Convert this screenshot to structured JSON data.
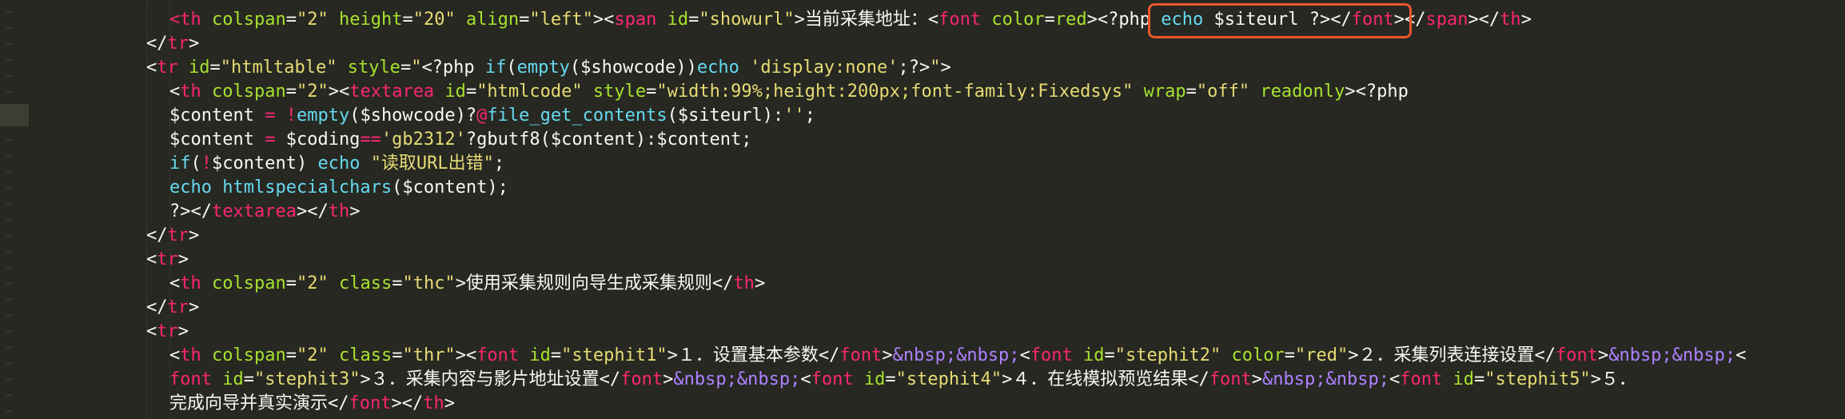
{
  "editor": {
    "theme": "monokai",
    "colors": {
      "background": "#272822",
      "tag": "#f92672",
      "attribute": "#a6e22e",
      "string": "#e6db74",
      "keyword": "#66d9ef",
      "text": "#f8f8f2",
      "entity": "#ae81ff",
      "annotation": "#e8572a"
    },
    "lines": [
      [
        [
          "tag",
          "<th"
        ],
        [
          "pl",
          " "
        ],
        [
          "attr",
          "colspan"
        ],
        [
          "pl",
          "="
        ],
        [
          "str",
          "\"2\""
        ],
        [
          "pl",
          " "
        ],
        [
          "attr",
          "height"
        ],
        [
          "pl",
          "="
        ],
        [
          "str",
          "\"20\""
        ],
        [
          "pl",
          " "
        ],
        [
          "attr",
          "align"
        ],
        [
          "pl",
          "="
        ],
        [
          "str",
          "\"left\""
        ],
        [
          "pl",
          "><"
        ],
        [
          "tag",
          "span"
        ],
        [
          "pl",
          " "
        ],
        [
          "attr",
          "id"
        ],
        [
          "pl",
          "="
        ],
        [
          "str",
          "\"showurl\""
        ],
        [
          "pl",
          ">当前采集地址：<"
        ],
        [
          "tag",
          "font"
        ],
        [
          "pl",
          " "
        ],
        [
          "attr",
          "color"
        ],
        [
          "pl",
          "="
        ],
        [
          "attr",
          "red"
        ],
        [
          "pl",
          "><?php "
        ],
        [
          "kw",
          "echo"
        ],
        [
          "pl",
          " $siteurl ?></"
        ],
        [
          "tag",
          "font"
        ],
        [
          "pl",
          "></"
        ],
        [
          "tag",
          "span"
        ],
        [
          "pl",
          "></"
        ],
        [
          "tag",
          "th"
        ],
        [
          "pl",
          ">"
        ]
      ],
      [
        [
          "pl",
          "</"
        ],
        [
          "tag",
          "tr"
        ],
        [
          "pl",
          ">"
        ]
      ],
      [
        [
          "pl",
          "<"
        ],
        [
          "tag",
          "tr"
        ],
        [
          "pl",
          " "
        ],
        [
          "attr",
          "id"
        ],
        [
          "pl",
          "="
        ],
        [
          "str",
          "\"htmltable\""
        ],
        [
          "pl",
          " "
        ],
        [
          "attr",
          "style"
        ],
        [
          "pl",
          "="
        ],
        [
          "str",
          "\""
        ],
        [
          "pl",
          "<?php "
        ],
        [
          "kw",
          "if"
        ],
        [
          "pl",
          "("
        ],
        [
          "fn",
          "empty"
        ],
        [
          "pl",
          "($showcode))"
        ],
        [
          "kw",
          "echo"
        ],
        [
          "pl",
          " "
        ],
        [
          "str",
          "'display:none'"
        ],
        [
          "pl",
          ";?>"
        ],
        [
          "str",
          "\""
        ],
        [
          "pl",
          ">"
        ]
      ],
      [
        [
          "pl",
          "<"
        ],
        [
          "tag",
          "th"
        ],
        [
          "pl",
          " "
        ],
        [
          "attr",
          "colspan"
        ],
        [
          "pl",
          "="
        ],
        [
          "str",
          "\"2\""
        ],
        [
          "pl",
          "><"
        ],
        [
          "tag",
          "textarea"
        ],
        [
          "pl",
          " "
        ],
        [
          "attr",
          "id"
        ],
        [
          "pl",
          "="
        ],
        [
          "str",
          "\"htmlcode\""
        ],
        [
          "pl",
          " "
        ],
        [
          "attr",
          "style"
        ],
        [
          "pl",
          "="
        ],
        [
          "str",
          "\"width:99%;height:200px;font-family:Fixedsys\""
        ],
        [
          "pl",
          " "
        ],
        [
          "attr",
          "wrap"
        ],
        [
          "pl",
          "="
        ],
        [
          "str",
          "\"off\""
        ],
        [
          "pl",
          " "
        ],
        [
          "attr",
          "readonly"
        ],
        [
          "pl",
          "><?php"
        ]
      ],
      [
        [
          "pl",
          "$content "
        ],
        [
          "op",
          "="
        ],
        [
          "pl",
          " "
        ],
        [
          "op",
          "!"
        ],
        [
          "fn",
          "empty"
        ],
        [
          "pl",
          "($showcode)?"
        ],
        [
          "op",
          "@"
        ],
        [
          "fn",
          "file_get_contents"
        ],
        [
          "pl",
          "($siteurl):"
        ],
        [
          "str",
          "''"
        ],
        [
          "pl",
          ";"
        ]
      ],
      [
        [
          "pl",
          "$content "
        ],
        [
          "op",
          "="
        ],
        [
          "pl",
          " $coding"
        ],
        [
          "op",
          "=="
        ],
        [
          "str",
          "'gb2312'"
        ],
        [
          "pl",
          "?gbutf8($content):$content;"
        ]
      ],
      [
        [
          "kw",
          "if"
        ],
        [
          "pl",
          "("
        ],
        [
          "op",
          "!"
        ],
        [
          "pl",
          "$content) "
        ],
        [
          "kw",
          "echo"
        ],
        [
          "pl",
          " "
        ],
        [
          "str",
          "\"读取URL出错\""
        ],
        [
          "pl",
          ";"
        ]
      ],
      [
        [
          "kw",
          "echo"
        ],
        [
          "pl",
          " "
        ],
        [
          "fn",
          "htmlspecialchars"
        ],
        [
          "pl",
          "($content);"
        ]
      ],
      [
        [
          "pl",
          "?></"
        ],
        [
          "tag",
          "textarea"
        ],
        [
          "pl",
          "></"
        ],
        [
          "tag",
          "th"
        ],
        [
          "pl",
          ">"
        ]
      ],
      [
        [
          "pl",
          "</"
        ],
        [
          "tag",
          "tr"
        ],
        [
          "pl",
          ">"
        ]
      ],
      [
        [
          "pl",
          "<"
        ],
        [
          "tag",
          "tr"
        ],
        [
          "pl",
          ">"
        ]
      ],
      [
        [
          "pl",
          "<"
        ],
        [
          "tag",
          "th"
        ],
        [
          "pl",
          " "
        ],
        [
          "attr",
          "colspan"
        ],
        [
          "pl",
          "="
        ],
        [
          "str",
          "\"2\""
        ],
        [
          "pl",
          " "
        ],
        [
          "attr",
          "class"
        ],
        [
          "pl",
          "="
        ],
        [
          "str",
          "\"thc\""
        ],
        [
          "pl",
          ">使用采集规则向导生成采集规则</"
        ],
        [
          "tag",
          "th"
        ],
        [
          "pl",
          ">"
        ]
      ],
      [
        [
          "pl",
          "</"
        ],
        [
          "tag",
          "tr"
        ],
        [
          "pl",
          ">"
        ]
      ],
      [
        [
          "pl",
          "<"
        ],
        [
          "tag",
          "tr"
        ],
        [
          "pl",
          ">"
        ]
      ],
      [
        [
          "pl",
          "<"
        ],
        [
          "tag",
          "th"
        ],
        [
          "pl",
          " "
        ],
        [
          "attr",
          "colspan"
        ],
        [
          "pl",
          "="
        ],
        [
          "str",
          "\"2\""
        ],
        [
          "pl",
          " "
        ],
        [
          "attr",
          "class"
        ],
        [
          "pl",
          "="
        ],
        [
          "str",
          "\"thr\""
        ],
        [
          "pl",
          "><"
        ],
        [
          "tag",
          "font"
        ],
        [
          "pl",
          " "
        ],
        [
          "attr",
          "id"
        ],
        [
          "pl",
          "="
        ],
        [
          "str",
          "\"stephit1\""
        ],
        [
          "pl",
          ">１．设置基本参数</"
        ],
        [
          "tag",
          "font"
        ],
        [
          "pl",
          ">"
        ],
        [
          "ent",
          "&nbsp;&nbsp;"
        ],
        [
          "pl",
          "<"
        ],
        [
          "tag",
          "font"
        ],
        [
          "pl",
          " "
        ],
        [
          "attr",
          "id"
        ],
        [
          "pl",
          "="
        ],
        [
          "str",
          "\"stephit2\""
        ],
        [
          "pl",
          " "
        ],
        [
          "attr",
          "color"
        ],
        [
          "pl",
          "="
        ],
        [
          "str",
          "\"red\""
        ],
        [
          "pl",
          ">２．采集列表连接设置</"
        ],
        [
          "tag",
          "font"
        ],
        [
          "pl",
          ">"
        ],
        [
          "ent",
          "&nbsp;&nbsp;"
        ],
        [
          "pl",
          "<"
        ]
      ],
      [
        [
          "tag",
          "font"
        ],
        [
          "pl",
          " "
        ],
        [
          "attr",
          "id"
        ],
        [
          "pl",
          "="
        ],
        [
          "str",
          "\"stephit3\""
        ],
        [
          "pl",
          ">３．采集内容与影片地址设置</"
        ],
        [
          "tag",
          "font"
        ],
        [
          "pl",
          ">"
        ],
        [
          "ent",
          "&nbsp;&nbsp;"
        ],
        [
          "pl",
          "<"
        ],
        [
          "tag",
          "font"
        ],
        [
          "pl",
          " "
        ],
        [
          "attr",
          "id"
        ],
        [
          "pl",
          "="
        ],
        [
          "str",
          "\"stephit4\""
        ],
        [
          "pl",
          ">４．在线模拟预览结果</"
        ],
        [
          "tag",
          "font"
        ],
        [
          "pl",
          ">"
        ],
        [
          "ent",
          "&nbsp;&nbsp;"
        ],
        [
          "pl",
          "<"
        ],
        [
          "tag",
          "font"
        ],
        [
          "pl",
          " "
        ],
        [
          "attr",
          "id"
        ],
        [
          "pl",
          "="
        ],
        [
          "str",
          "\"stephit5\""
        ],
        [
          "pl",
          ">５．"
        ]
      ],
      [
        [
          "pl",
          "完成向导并真实演示</"
        ],
        [
          "tag",
          "font"
        ],
        [
          "pl",
          "></"
        ],
        [
          "tag",
          "th"
        ],
        [
          "pl",
          ">"
        ]
      ]
    ]
  }
}
